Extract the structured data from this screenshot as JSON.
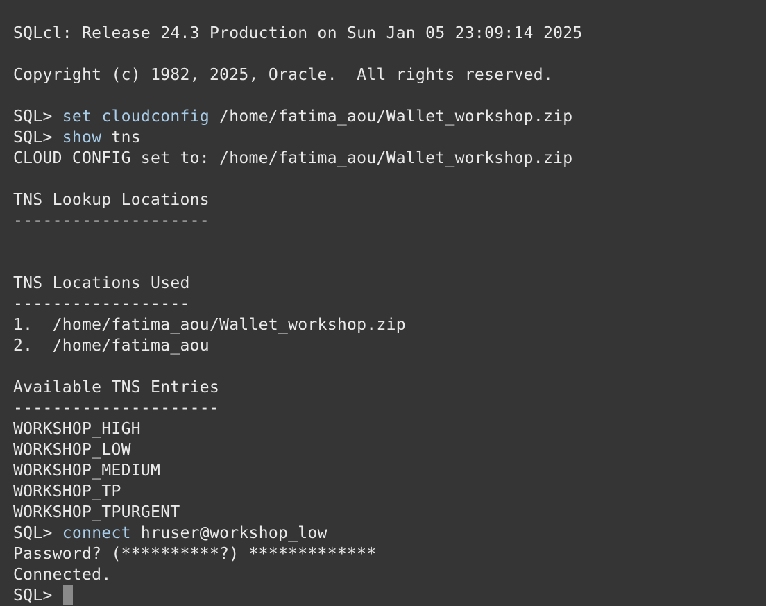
{
  "terminal": {
    "banner": "SQLcl: Release 24.3 Production on Sun Jan 05 23:09:14 2025",
    "copyright": "Copyright (c) 1982, 2025, Oracle.  All rights reserved.",
    "prompt": "SQL> ",
    "cmd1": {
      "keyword1": "set",
      "keyword2": "cloudconfig",
      "arg": " /home/fatima_aou/Wallet_workshop.zip"
    },
    "cmd2": {
      "keyword": "show",
      "arg": " tns"
    },
    "cloud_config": "CLOUD CONFIG set to: /home/fatima_aou/Wallet_workshop.zip",
    "lookup_heading": "TNS Lookup Locations",
    "lookup_rule": "--------------------",
    "used_heading": "TNS Locations Used",
    "used_rule": "------------------",
    "used_locations": [
      "1.  /home/fatima_aou/Wallet_workshop.zip",
      "2.  /home/fatima_aou"
    ],
    "entries_heading": "Available TNS Entries",
    "entries_rule": "---------------------",
    "entries": [
      "WORKSHOP_HIGH",
      "WORKSHOP_LOW",
      "WORKSHOP_MEDIUM",
      "WORKSHOP_TP",
      "WORKSHOP_TPURGENT"
    ],
    "cmd3": {
      "keyword": "connect",
      "arg": " hruser@workshop_low"
    },
    "password_line": "Password? (**********?) *************",
    "connected": "Connected.",
    "final_prompt": "SQL> "
  },
  "colors": {
    "background": "#353535",
    "text": "#eaeaea",
    "keyword": "#a8cdea",
    "cursor": "#8a8a8a"
  }
}
